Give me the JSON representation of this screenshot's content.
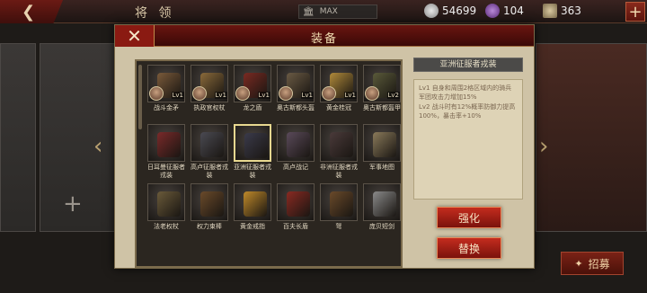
{
  "topbar": {
    "title": "将 领",
    "max_label": "MAX",
    "silver": "54699",
    "gems": "104",
    "scrolls": "363"
  },
  "modal": {
    "title": "装备",
    "enhance_label": "强化",
    "replace_label": "替换"
  },
  "detail": {
    "title": "亚洲征服者戎装",
    "lines": [
      "Lv1  自身和周围2格区域内的骑兵军团攻击力增加15%",
      "Lv2  战斗时有12%概率防御力提高100%，暴击率+10%"
    ]
  },
  "items": [
    {
      "name": "战斗金矛",
      "lv": "Lv1",
      "color": "#7a5a3a"
    },
    {
      "name": "执政官权杖",
      "lv": "Lv1",
      "color": "#8a6a3a"
    },
    {
      "name": "龙之盾",
      "lv": "Lv1",
      "color": "#7a2a22"
    },
    {
      "name": "奥古斯都头盔",
      "lv": "Lv1",
      "color": "#6a5a44"
    },
    {
      "name": "黄金桂冠",
      "lv": "Lv1",
      "color": "#b08a3a"
    },
    {
      "name": "奥古斯都盔甲",
      "lv": "Lv2",
      "color": "#5a5a3a"
    },
    {
      "name": "日耳曼征服者戎装",
      "lv": "",
      "color": "#7a2a2a"
    },
    {
      "name": "高卢征服者戎装",
      "lv": "",
      "color": "#4a4a52"
    },
    {
      "name": "亚洲征服者戎装",
      "lv": "",
      "color": "#3a3a4a"
    },
    {
      "name": "高卢战记",
      "lv": "",
      "color": "#5a4a5a"
    },
    {
      "name": "非洲征服者戎装",
      "lv": "",
      "color": "#4a3a3a"
    },
    {
      "name": "军事地图",
      "lv": "",
      "color": "#8a7a5a"
    },
    {
      "name": "法老权杖",
      "lv": "",
      "color": "#6a5a3a"
    },
    {
      "name": "权力束棒",
      "lv": "",
      "color": "#6a4a2a"
    },
    {
      "name": "黄金戒指",
      "lv": "",
      "color": "#c08a2a"
    },
    {
      "name": "百夫长盾",
      "lv": "",
      "color": "#8a2a22"
    },
    {
      "name": "弩",
      "lv": "",
      "color": "#6a4a2a"
    },
    {
      "name": "庞贝短剑",
      "lv": "",
      "color": "#8a8a8a"
    }
  ],
  "background": {
    "recruit_label": "招募"
  },
  "colors": {
    "accent_red": "#8a1a12",
    "panel_bg": "#cfc3a6",
    "grid_bg": "#2b2620"
  }
}
